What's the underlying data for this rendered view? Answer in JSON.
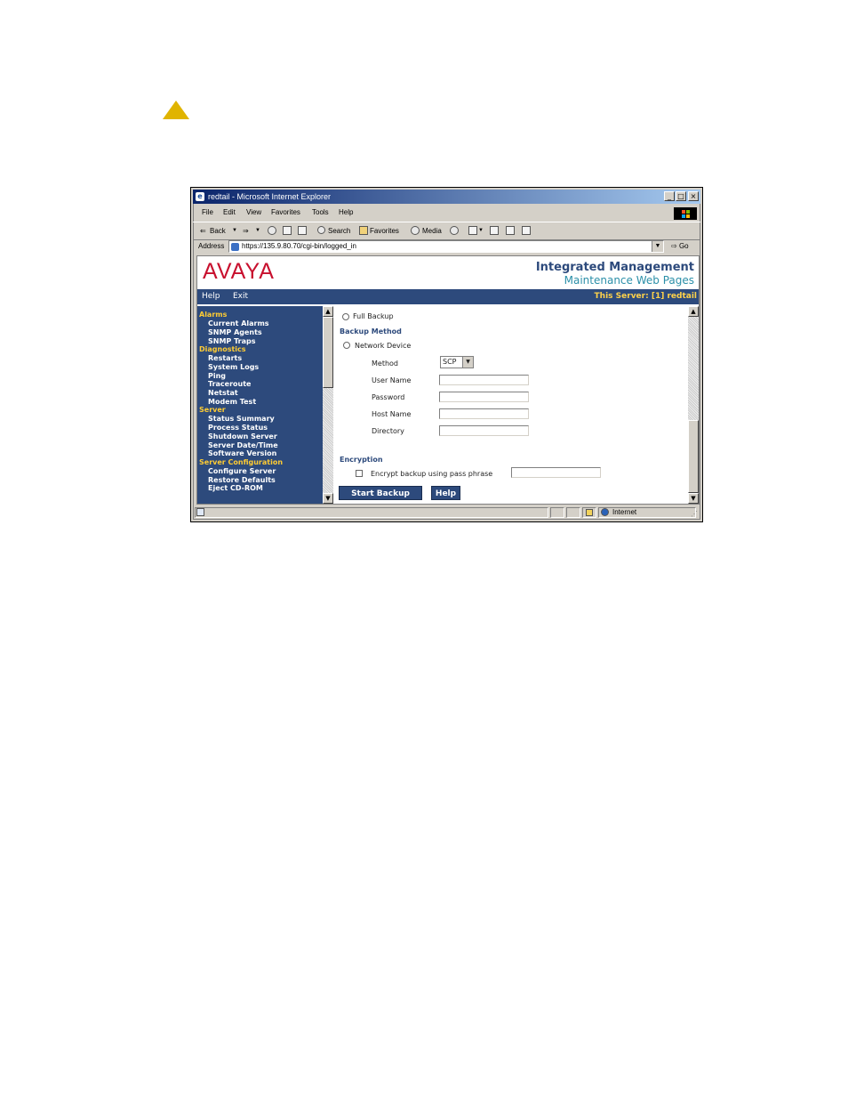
{
  "window": {
    "title": "redtail - Microsoft Internet Explorer"
  },
  "menu": [
    "File",
    "Edit",
    "View",
    "Favorites",
    "Tools",
    "Help"
  ],
  "toolbar": {
    "back": "Back",
    "search": "Search",
    "favorites": "Favorites",
    "media": "Media"
  },
  "address": {
    "label": "Address",
    "url": "https://135.9.80.70/cgi-bin/logged_in",
    "go": "Go"
  },
  "header": {
    "logo": "AVAYA",
    "title": "Integrated Management",
    "subtitle": "Maintenance Web Pages"
  },
  "nav": {
    "help": "Help",
    "exit": "Exit",
    "server": "This Server: [1] redtail"
  },
  "sidebar": {
    "sections": [
      {
        "title": "Alarms",
        "items": [
          "Current Alarms",
          "SNMP Agents",
          "SNMP Traps"
        ]
      },
      {
        "title": "Diagnostics",
        "items": [
          "Restarts",
          "System Logs",
          "Ping",
          "Traceroute",
          "Netstat",
          "Modem Test"
        ]
      },
      {
        "title": "Server",
        "items": [
          "Status Summary",
          "Process Status",
          "Shutdown Server",
          "Server Date/Time",
          "Software Version"
        ]
      },
      {
        "title": "Server Configuration",
        "items": [
          "Configure Server",
          "Restore Defaults",
          "Eject CD-ROM"
        ]
      }
    ]
  },
  "form": {
    "full_backup": "Full Backup",
    "backup_method_heading": "Backup Method",
    "network_device": "Network Device",
    "method_label": "Method",
    "method_value": "SCP",
    "user_name_label": "User Name",
    "password_label": "Password",
    "host_name_label": "Host Name",
    "directory_label": "Directory",
    "encryption_heading": "Encryption",
    "encrypt_label": "Encrypt backup using pass phrase",
    "start_button": "Start Backup",
    "help_button": "Help"
  },
  "status": {
    "zone": "Internet"
  },
  "colors": {
    "navy": "#2d4a7c",
    "accent_yellow": "#ffcc33",
    "avaya_red": "#c8102e",
    "teal": "#2b8fa8",
    "warning": "#e0b400"
  }
}
